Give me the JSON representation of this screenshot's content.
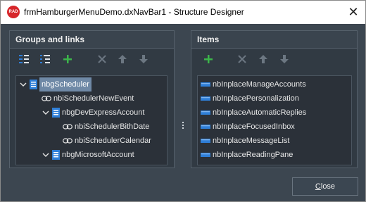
{
  "window": {
    "title": "frmHamburgerMenuDemo.dxNavBar1 - Structure Designer",
    "app_icon_text": "RAD",
    "close_glyph": "✕"
  },
  "groups_panel": {
    "header": "Groups and links",
    "tree": [
      {
        "label": "nbgScheduler",
        "kind": "group",
        "selected": true,
        "expanded": true
      },
      {
        "label": "nbiSchedulerNewEvent",
        "kind": "link"
      },
      {
        "label": "nbgDevExpressAccount",
        "kind": "group",
        "expanded": true
      },
      {
        "label": "nbiSchedulerBithDate",
        "kind": "link"
      },
      {
        "label": "nbiSchedulerCalendar",
        "kind": "link"
      },
      {
        "label": "nbgMicrosoftAccount",
        "kind": "group",
        "expanded": true
      }
    ]
  },
  "items_panel": {
    "header": "Items",
    "items": [
      {
        "label": "nbInplaceManageAccounts"
      },
      {
        "label": "nbInplacePersonalization"
      },
      {
        "label": "nbInplaceAutomaticReplies"
      },
      {
        "label": "nbInplaceFocusedInbox"
      },
      {
        "label": "nbInplaceMessageList"
      },
      {
        "label": "nbInplaceReadingPane"
      }
    ]
  },
  "buttons": {
    "close_first": "C",
    "close_rest": "lose"
  },
  "colors": {
    "background": "#3c4650",
    "panel": "#313a43",
    "list": "#2b3139",
    "selection": "#6f89a6",
    "add_green": "#3cb54a",
    "item_blue": "#2f7fd8"
  }
}
